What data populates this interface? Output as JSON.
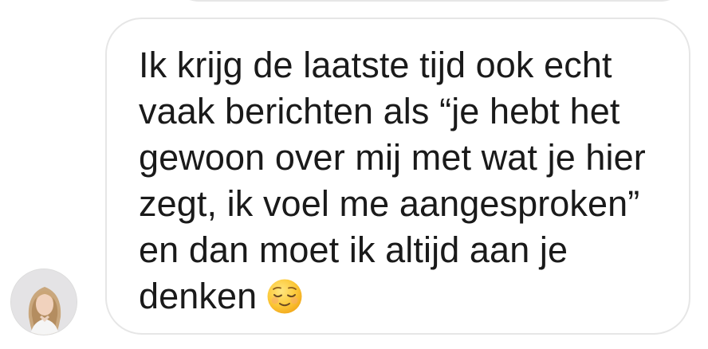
{
  "message": {
    "lines": [
      "Ik krijg de laatste tijd ook echt",
      "vaak berichten als “je hebt het",
      "gewoon over mij met wat je hier",
      "zegt, ik voel me aangesproken”",
      "en dan moet ik altijd aan je",
      "denken"
    ],
    "emoji": "relieved-face-icon"
  },
  "sender": {
    "avatar": "profile-photo"
  },
  "colors": {
    "bubble_border": "#e6e6e6",
    "text": "#1a1a1a",
    "background": "#ffffff"
  }
}
